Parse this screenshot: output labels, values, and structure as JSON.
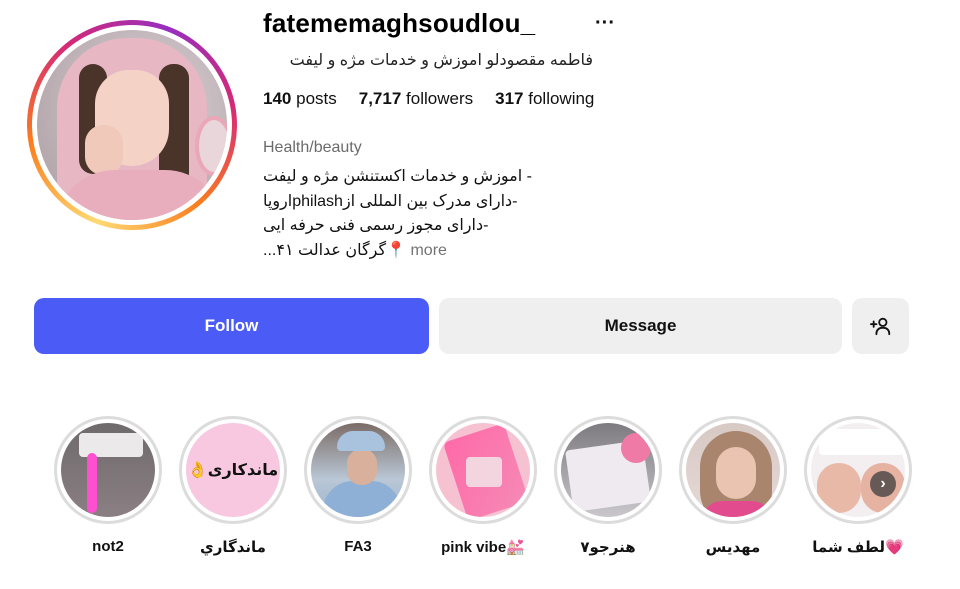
{
  "profile": {
    "username": "fatememaghsoudlou_",
    "full_name": "فاطمه مقصودلو اموزش و خدمات مژه و لیفت",
    "category": "Health/beauty",
    "more_icon": "more-horizontal-icon"
  },
  "stats": {
    "posts_count": "140",
    "posts_label": "posts",
    "followers_count": "7,717",
    "followers_label": "followers",
    "following_count": "317",
    "following_label": "following"
  },
  "bio": {
    "line1": "- اموزش و خدمات اکستنشن مژه و لیفت",
    "line2": "-دارای مدرک بین المللی ازphilashاروپا",
    "line3": "-دارای مجوز رسمی فنی حرفه ایی",
    "line4": "📍گرگان عدالت ۴۱...",
    "more": "more"
  },
  "actions": {
    "follow": "Follow",
    "message": "Message",
    "add_user_icon": "person-add-icon"
  },
  "highlights": [
    {
      "label": "not2"
    },
    {
      "label": "ماندگاري",
      "cover_text": "ماندکاری👌"
    },
    {
      "label": "FA3"
    },
    {
      "label": "pink vibe💒"
    },
    {
      "label": "هنرجو۷"
    },
    {
      "label": "مهديس"
    },
    {
      "label": "لطف شما💗"
    }
  ],
  "colors": {
    "follow_button": "#4a5cf5",
    "secondary_button": "#efefef",
    "muted_text": "#737373"
  }
}
